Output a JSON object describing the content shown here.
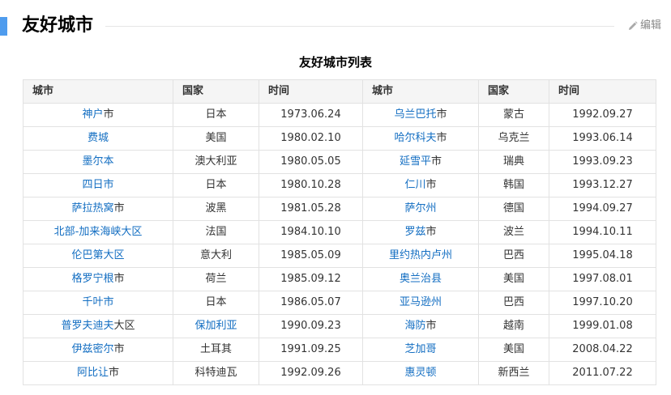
{
  "section": {
    "title": "友好城市",
    "edit_label": "编辑"
  },
  "table": {
    "caption": "友好城市列表",
    "headers": [
      "城市",
      "国家",
      "时间",
      "城市",
      "国家",
      "时间"
    ],
    "rows": [
      {
        "l_link": "神户",
        "l_suffix": "市",
        "l_country": "日本",
        "l_country_link": false,
        "l_date": "1973.06.24",
        "r_link": "乌兰巴托",
        "r_suffix": "市",
        "r_country": "蒙古",
        "r_date": "1992.09.27"
      },
      {
        "l_link": "费城",
        "l_suffix": "",
        "l_country": "美国",
        "l_country_link": false,
        "l_date": "1980.02.10",
        "r_link": "哈尔科夫",
        "r_suffix": "市",
        "r_country": "乌克兰",
        "r_date": "1993.06.14"
      },
      {
        "l_link": "墨尔本",
        "l_suffix": "",
        "l_country": "澳大利亚",
        "l_country_link": false,
        "l_date": "1980.05.05",
        "r_link": "延雪平",
        "r_suffix": "市",
        "r_country": "瑞典",
        "r_date": "1993.09.23"
      },
      {
        "l_link": "四日市",
        "l_suffix": "",
        "l_country": "日本",
        "l_country_link": false,
        "l_date": "1980.10.28",
        "r_link": "仁川",
        "r_suffix": "市",
        "r_country": "韩国",
        "r_date": "1993.12.27"
      },
      {
        "l_link": "萨拉热窝",
        "l_suffix": "市",
        "l_country": "波黑",
        "l_country_link": false,
        "l_date": "1981.05.28",
        "r_link": "萨尔州",
        "r_suffix": "",
        "r_country": "德国",
        "r_date": "1994.09.27"
      },
      {
        "l_link": "北部-加来海峡大区",
        "l_suffix": "",
        "l_country": "法国",
        "l_country_link": false,
        "l_date": "1984.10.10",
        "r_link": "罗兹",
        "r_suffix": "市",
        "r_country": "波兰",
        "r_date": "1994.10.11"
      },
      {
        "l_link": "伦巴第大区",
        "l_suffix": "",
        "l_country": "意大利",
        "l_country_link": false,
        "l_date": "1985.05.09",
        "r_link": "里约热内卢州",
        "r_suffix": "",
        "r_country": "巴西",
        "r_date": "1995.04.18"
      },
      {
        "l_link": "格罗宁根",
        "l_suffix": "市",
        "l_country": "荷兰",
        "l_country_link": false,
        "l_date": "1985.09.12",
        "r_link": "奥兰治县",
        "r_suffix": "",
        "r_country": "美国",
        "r_date": "1997.08.01"
      },
      {
        "l_link": "千叶市",
        "l_suffix": "",
        "l_country": "日本",
        "l_country_link": false,
        "l_date": "1986.05.07",
        "r_link": "亚马逊州",
        "r_suffix": "",
        "r_country": "巴西",
        "r_date": "1997.10.20"
      },
      {
        "l_link": "普罗夫迪夫",
        "l_suffix": "大区",
        "l_country": "保加利亚",
        "l_country_link": true,
        "l_date": "1990.09.23",
        "r_link": "海防",
        "r_suffix": "市",
        "r_country": "越南",
        "r_date": "1999.01.08"
      },
      {
        "l_link": "伊兹密尔",
        "l_suffix": "市",
        "l_country": "土耳其",
        "l_country_link": false,
        "l_date": "1991.09.25",
        "r_link": "芝加哥",
        "r_suffix": "",
        "r_country": "美国",
        "r_date": "2008.04.22"
      },
      {
        "l_link": "阿比让",
        "l_suffix": "市",
        "l_country": "科特迪瓦",
        "l_country_link": false,
        "l_date": "1992.09.26",
        "r_link": "惠灵顿",
        "r_suffix": "",
        "r_country": "新西兰",
        "r_date": "2011.07.22"
      }
    ]
  },
  "colors": {
    "accent": "#4f9cee",
    "link": "#136ec2",
    "header_bg": "#f5f5f5",
    "border": "#e2e2e2"
  }
}
